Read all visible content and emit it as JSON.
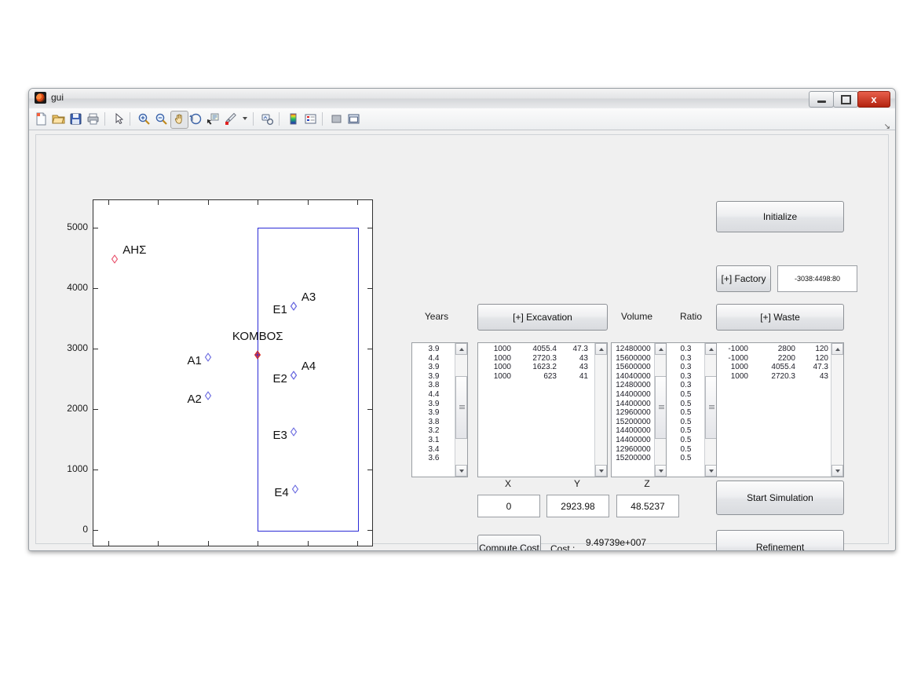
{
  "window": {
    "title": "gui",
    "ghost_title": "",
    "minimize_label": "Minimize",
    "maximize_label": "Maximize",
    "close_label": "x"
  },
  "toolbar": {
    "items": [
      {
        "name": "new-figure-icon",
        "label": "New Figure"
      },
      {
        "name": "open-file-icon",
        "label": "Open File"
      },
      {
        "name": "save-figure-icon",
        "label": "Save Figure"
      },
      {
        "name": "print-figure-icon",
        "label": "Print Figure"
      },
      {
        "name": "pointer-icon",
        "label": "Edit Plot"
      },
      {
        "name": "zoom-in-icon",
        "label": "Zoom In"
      },
      {
        "name": "zoom-out-icon",
        "label": "Zoom Out"
      },
      {
        "name": "pan-icon",
        "label": "Pan"
      },
      {
        "name": "rotate-3d-icon",
        "label": "Rotate 3D"
      },
      {
        "name": "data-cursor-icon",
        "label": "Data Cursor"
      },
      {
        "name": "brush-icon",
        "label": "Brush/Select Data"
      },
      {
        "name": "link-plot-icon",
        "label": "Link Plot"
      },
      {
        "name": "colorbar-icon",
        "label": "Insert Colorbar"
      },
      {
        "name": "legend-icon",
        "label": "Insert Legend"
      },
      {
        "name": "hide-plot-tools-icon",
        "label": "Hide Plot Tools"
      },
      {
        "name": "show-plot-tools-icon",
        "label": "Show Plot Tools"
      }
    ],
    "collapse_glyph": "↘"
  },
  "chart_data": {
    "type": "scatter",
    "title": "",
    "xlabel": "",
    "ylabel": "",
    "xlim": [
      -3300,
      2300
    ],
    "ylim": [
      -260,
      5450
    ],
    "xticks": [
      -3000,
      -2000,
      -1000,
      0,
      1000,
      2000
    ],
    "yticks": [
      0,
      1000,
      2000,
      3000,
      4000,
      5000
    ],
    "grid": false,
    "legend": "none",
    "points": [
      {
        "label": "ΑΗΣ",
        "x": -2870,
        "y": 4500,
        "color": "#e8506b",
        "label_side": "right"
      },
      {
        "label": "A1",
        "x": -1000,
        "y": 2880,
        "color": "#6a6ae0",
        "label_side": "left"
      },
      {
        "label": "A2",
        "x": -1000,
        "y": 2240,
        "color": "#6a6ae0",
        "label_side": "left"
      },
      {
        "label": "A3",
        "x": 720,
        "y": 3720,
        "color": "#6a6ae0",
        "label_side": "right"
      },
      {
        "label": "A4",
        "x": 720,
        "y": 2580,
        "color": "#6a6ae0",
        "label_side": "right"
      },
      {
        "label": "E1",
        "x": 720,
        "y": 3720,
        "color": "#6a6ae0",
        "label_side": "left"
      },
      {
        "label": "E2",
        "x": 720,
        "y": 2580,
        "color": "#6a6ae0",
        "label_side": "left"
      },
      {
        "label": "E3",
        "x": 720,
        "y": 1650,
        "color": "#6a6ae0",
        "label_side": "left"
      },
      {
        "label": "E4",
        "x": 750,
        "y": 700,
        "color": "#6a6ae0",
        "label_side": "left"
      },
      {
        "label": "ΚΟΜΒΟΣ",
        "x": 0,
        "y": 2923.98,
        "color": "#e03020",
        "label_side": "above"
      }
    ],
    "rectangle": {
      "x0": 0,
      "y0": 0,
      "x1": 2000,
      "y1": 5000,
      "color": "#2b2bd6"
    }
  },
  "panel": {
    "initialize_label": "Initialize",
    "factory_button_label": "[+] Factory",
    "factory_value": "-3038:4498:80",
    "waste_button_label": "[+] Waste",
    "excavation_button_label": "[+] Excavation",
    "start_simulation_label": "Start Simulation",
    "refinement_label": "Refinement",
    "compute_cost_label": "Compute Cost",
    "cost_label": "Cost :",
    "cost_value": "9.49739e+007",
    "headers": {
      "years": "Years",
      "volume": "Volume",
      "ratio": "Ratio",
      "x": "X",
      "y": "Y",
      "z": "Z"
    },
    "coords": {
      "x_value": "0",
      "y_value": "2923.98",
      "z_value": "48.5237"
    },
    "years_list": [
      "3.9",
      "4.4",
      "3.9",
      "3.9",
      "3.8",
      "4.4",
      "3.9",
      "3.9",
      "3.8",
      "3.2",
      "3.1",
      "3.4",
      "3.6"
    ],
    "excavation_list": [
      [
        "1000",
        "4055.4",
        "47.3"
      ],
      [
        "1000",
        "2720.3",
        "43"
      ],
      [
        "1000",
        "1623.2",
        "43"
      ],
      [
        "1000",
        "623",
        "41"
      ]
    ],
    "volume_list": [
      "12480000",
      "15600000",
      "15600000",
      "14040000",
      "12480000",
      "14400000",
      "14400000",
      "12960000",
      "15200000",
      "14400000",
      "14400000",
      "12960000",
      "15200000"
    ],
    "ratio_list": [
      "0.3",
      "0.3",
      "0.3",
      "0.3",
      "0.3",
      "0.5",
      "0.5",
      "0.5",
      "0.5",
      "0.5",
      "0.5",
      "0.5",
      "0.5"
    ],
    "waste_list": [
      [
        "-1000",
        "2800",
        "120"
      ],
      [
        "-1000",
        "2200",
        "120"
      ],
      [
        "1000",
        "4055.4",
        "47.3"
      ],
      [
        "1000",
        "2720.3",
        "43"
      ]
    ]
  },
  "colors": {
    "window_bg": "#f0f0f0",
    "axes_bg": "#ffffff",
    "marker_blue": "#6a6ae0",
    "marker_red": "#e8506b",
    "node_red": "#e03020",
    "pit_outline": "#2b2bd6",
    "close_button": "#b3230f"
  }
}
